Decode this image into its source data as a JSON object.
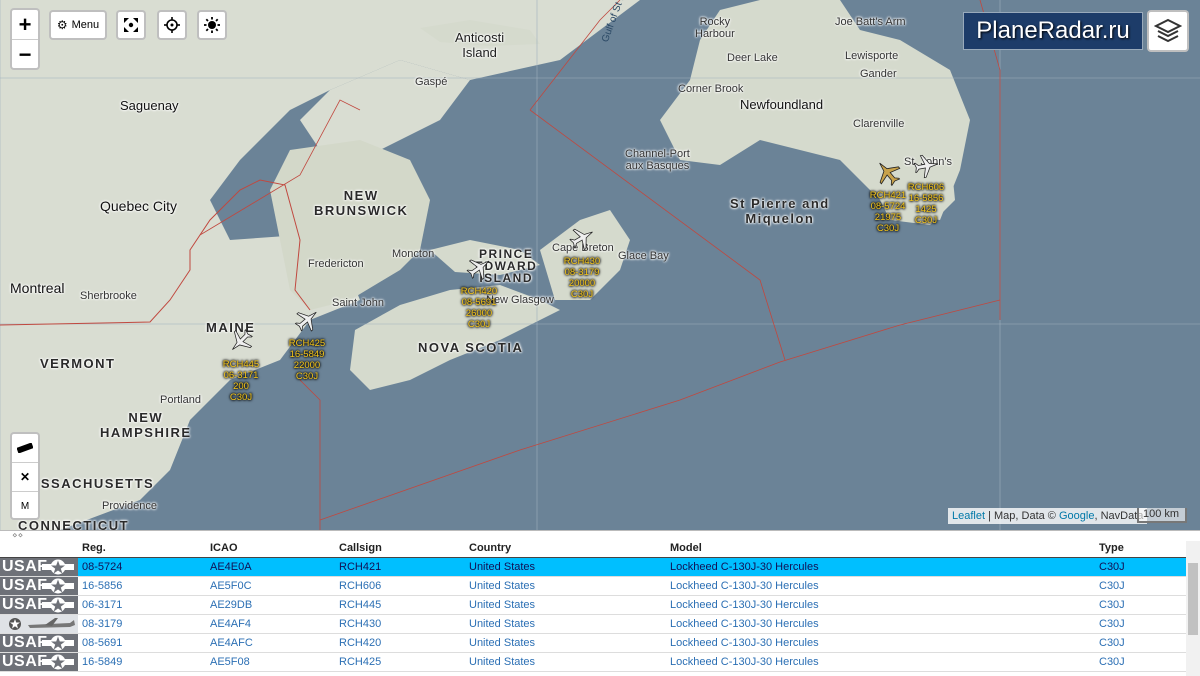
{
  "brand": {
    "text": "PlaneRadar.ru"
  },
  "controls": {
    "zoom_in": "+",
    "zoom_out": "−",
    "menu_label": "Menu",
    "tool_m": "M",
    "tool_x": "✕"
  },
  "colors": {
    "water": "#6b8397",
    "land": "#d8dcd1",
    "border": "#c0483f",
    "selected_row": "#00bfff",
    "plane_label": "#f3c419"
  },
  "map_labels": {
    "anticosti": "Anticosti\nIsland",
    "gaspe": "Gaspé",
    "saguenay": "Saguenay",
    "quebec_city": "Quebec City",
    "montreal": "Montreal",
    "sherbrooke": "Sherbrooke",
    "new_brunswick": "NEW\nBRUNSWICK",
    "fredericton": "Fredericton",
    "moncton": "Moncton",
    "saint_john": "Saint John",
    "maine": "MAINE",
    "vermont": "VERMONT",
    "new_hampshire": "NEW\nHAMPSHIRE",
    "massachusetts": "ASSACHUSETTS",
    "connecticut": "CONNECTICUT",
    "portland": "Portland",
    "providence": "Providence",
    "nova_scotia": "NOVA SCOTIA",
    "pei": "PRINCE\nEDWARD\nISLAND",
    "new_glasgow": "New Glasgow",
    "cape_breton": "Cape Breton",
    "glace_bay": "Glace Bay",
    "gulf": "Gulf of St Lawrence",
    "newfoundland": "Newfoundland",
    "channel": "Channel-Port\naux Basques",
    "st_pierre": "St Pierre and\nMiquelon",
    "corner_brook": "Corner Brook",
    "deer_lake": "Deer Lake",
    "rocky_harbour": "Rocky\nHarbour",
    "lewisporte": "Lewisporte",
    "joe_batts": "Joe Batt's Arm",
    "gander": "Gander",
    "clarenville": "Clarenville",
    "st_johns": "St. John's"
  },
  "attribution": {
    "leaflet": "Leaflet",
    "rest": " | Map, Data © ",
    "google": "Google",
    "tail": ", NavData"
  },
  "scale": {
    "label": "100 km"
  },
  "planes": [
    {
      "callsign": "RCH421",
      "reg": "08-5724",
      "alt": "21975",
      "type": "C30J",
      "selected": true
    },
    {
      "callsign": "RCH606",
      "reg": "16-5856",
      "alt": "1425",
      "type": "C30J",
      "selected": false
    },
    {
      "callsign": "RCH430",
      "reg": "08-3179",
      "alt": "20000",
      "type": "C30J",
      "selected": false
    },
    {
      "callsign": "RCH420",
      "reg": "08-5691",
      "alt": "26000",
      "type": "C30J",
      "selected": false
    },
    {
      "callsign": "RCH425",
      "reg": "16-5849",
      "alt": "22000",
      "type": "C30J",
      "selected": false
    },
    {
      "callsign": "RCH445",
      "reg": "06-3171",
      "alt": "200",
      "type": "C30J",
      "selected": false
    }
  ],
  "table": {
    "headers": {
      "reg": "Reg.",
      "icao": "ICAO",
      "callsign": "Callsign",
      "country": "Country",
      "model": "Model",
      "type": "Type"
    },
    "logo_text": "USAF",
    "rows": [
      {
        "reg": "08-5724",
        "icao": "AE4E0A",
        "callsign": "RCH421",
        "country": "United States",
        "model": "Lockheed C-130J-30 Hercules",
        "type": "C30J",
        "logo": "usaf",
        "selected": true
      },
      {
        "reg": "16-5856",
        "icao": "AE5F0C",
        "callsign": "RCH606",
        "country": "United States",
        "model": "Lockheed C-130J-30 Hercules",
        "type": "C30J",
        "logo": "usaf",
        "selected": false
      },
      {
        "reg": "06-3171",
        "icao": "AE29DB",
        "callsign": "RCH445",
        "country": "United States",
        "model": "Lockheed C-130J-30 Hercules",
        "type": "C30J",
        "logo": "usaf",
        "selected": false
      },
      {
        "reg": "08-3179",
        "icao": "AE4AF4",
        "callsign": "RCH430",
        "country": "United States",
        "model": "Lockheed C-130J-30 Hercules",
        "type": "C30J",
        "logo": "aircraft",
        "selected": false
      },
      {
        "reg": "08-5691",
        "icao": "AE4AFC",
        "callsign": "RCH420",
        "country": "United States",
        "model": "Lockheed C-130J-30 Hercules",
        "type": "C30J",
        "logo": "usaf",
        "selected": false
      },
      {
        "reg": "16-5849",
        "icao": "AE5F08",
        "callsign": "RCH425",
        "country": "United States",
        "model": "Lockheed C-130J-30 Hercules",
        "type": "C30J",
        "logo": "usaf",
        "selected": false
      }
    ]
  }
}
